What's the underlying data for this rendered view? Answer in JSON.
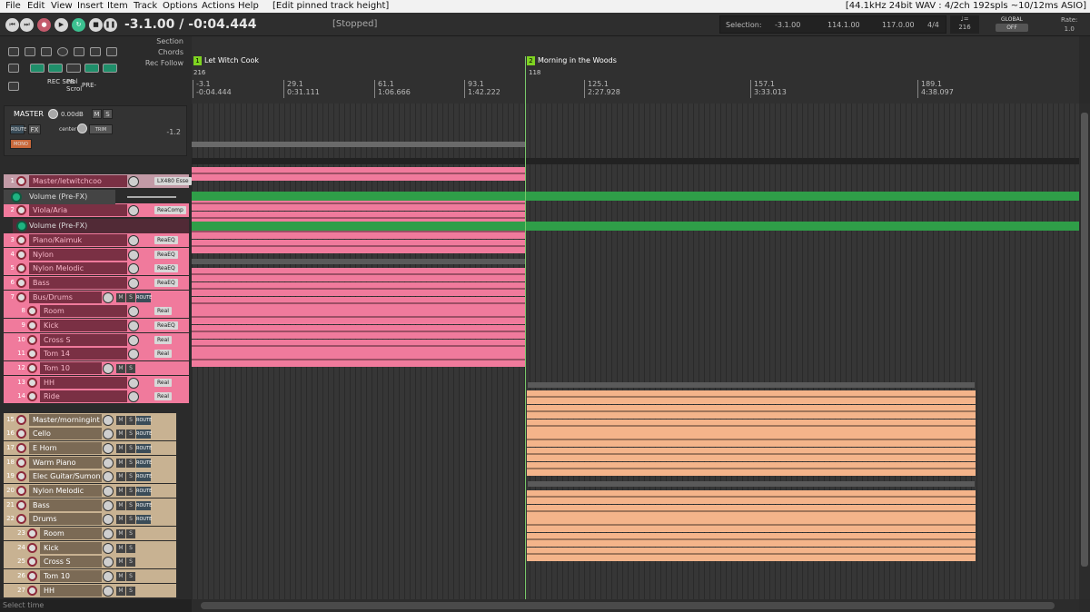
{
  "menu": {
    "items": [
      "File",
      "Edit",
      "View",
      "Insert",
      "Item",
      "Track",
      "Options",
      "Actions",
      "Help"
    ],
    "context": "[Edit pinned track height]",
    "status": "[44.1kHz 24bit WAV : 4/2ch 192spls ~10/12ms ASIO]"
  },
  "transport": {
    "time": "-3.1.00 / -0:04.444",
    "state": "[Stopped]",
    "selection_label": "Selection:",
    "sel_start": "-3.1.00",
    "sel_end": "114.1.00",
    "sel_len": "117.0.00",
    "timesig": "4/4",
    "bpm": "216",
    "global_label": "GLOBAL",
    "global_value": "OFF",
    "rate_label": "Rate:",
    "rate_value": "1.0"
  },
  "toolbar": {
    "section": "Section",
    "chords": "Chords",
    "rec_follow": "Rec Follow",
    "rec_scrol": "REC Scrol",
    "pb_scrol": "PB Scrol",
    "pre": "PRE-"
  },
  "master": {
    "name": "MASTER",
    "volume": "0.00dB",
    "m": "M",
    "s": "S",
    "route": "ROUTE",
    "fx": "FX",
    "pan": "center",
    "trim": "TRIM",
    "mono": "MONO",
    "meter": "-1.2"
  },
  "regions": [
    {
      "num": "1",
      "name": "Let Witch Cook",
      "bpm": "216"
    },
    {
      "num": "2",
      "name": "Morning in the Woods",
      "bpm": "118"
    }
  ],
  "ruler": [
    {
      "bar": "-3.1",
      "time": "-0:04.444"
    },
    {
      "bar": "29.1",
      "time": "0:31.111"
    },
    {
      "bar": "61.1",
      "time": "1:06.666"
    },
    {
      "bar": "93.1",
      "time": "1:42.222"
    },
    {
      "bar": "125.1",
      "time": "2:27.928"
    },
    {
      "bar": "157.1",
      "time": "3:33.013"
    },
    {
      "bar": "189.1",
      "time": "4:38.097"
    }
  ],
  "envelope_label": "Volume (Pre-FX)",
  "tracks": [
    {
      "num": "1",
      "name": "Master/letwitchcoo",
      "fx": "LX480 Esse",
      "folder": "master"
    },
    {
      "num": "2",
      "name": "Viola/Aria",
      "fx": "ReaComp"
    },
    {
      "num": "3",
      "name": "Piano/Kaimuk",
      "fx": "ReaEQ"
    },
    {
      "num": "4",
      "name": "Nylon",
      "fx": "ReaEQ"
    },
    {
      "num": "5",
      "name": "Nylon Melodic",
      "fx": "ReaEQ"
    },
    {
      "num": "6",
      "name": "Bass",
      "fx": "ReaEQ"
    },
    {
      "num": "7",
      "name": "Bus/Drums",
      "m": "M",
      "s": "S",
      "route": "ROUTE"
    },
    {
      "num": "8",
      "name": "Room",
      "fx": "ReaI"
    },
    {
      "num": "9",
      "name": "Kick",
      "fx": "ReaEQ"
    },
    {
      "num": "10",
      "name": "Cross S",
      "fx": "ReaI"
    },
    {
      "num": "11",
      "name": "Tom 14",
      "fx": "ReaI"
    },
    {
      "num": "12",
      "name": "Tom 10",
      "m": "M",
      "s": "S"
    },
    {
      "num": "13",
      "name": "HH",
      "fx": "ReaI"
    },
    {
      "num": "14",
      "name": "Ride",
      "fx": "ReaI"
    },
    {
      "num": "15",
      "name": "Master/morningint",
      "m": "M",
      "s": "S",
      "route": "ROUTE"
    },
    {
      "num": "16",
      "name": "Cello",
      "m": "M",
      "s": "S",
      "route": "ROUTE"
    },
    {
      "num": "17",
      "name": "E Horn",
      "m": "M",
      "s": "S",
      "route": "ROUTE"
    },
    {
      "num": "18",
      "name": "Warm Piano",
      "m": "M",
      "s": "S",
      "route": "ROUTE"
    },
    {
      "num": "19",
      "name": "Elec Guitar/Sumon",
      "m": "M",
      "s": "S",
      "route": "ROUTE"
    },
    {
      "num": "20",
      "name": "Nylon Melodic",
      "m": "M",
      "s": "S",
      "route": "ROUTE"
    },
    {
      "num": "21",
      "name": "Bass",
      "m": "M",
      "s": "S",
      "route": "ROUTE"
    },
    {
      "num": "22",
      "name": "Drums",
      "m": "M",
      "s": "S",
      "route": "ROUTE"
    },
    {
      "num": "23",
      "name": "Room",
      "m": "M",
      "s": "S"
    },
    {
      "num": "24",
      "name": "Kick",
      "m": "M",
      "s": "S"
    },
    {
      "num": "25",
      "name": "Cross S",
      "m": "M",
      "s": "S"
    },
    {
      "num": "26",
      "name": "Tom 10",
      "m": "M",
      "s": "S"
    },
    {
      "num": "27",
      "name": "HH",
      "m": "M",
      "s": "S"
    }
  ],
  "status_text": "Select time"
}
